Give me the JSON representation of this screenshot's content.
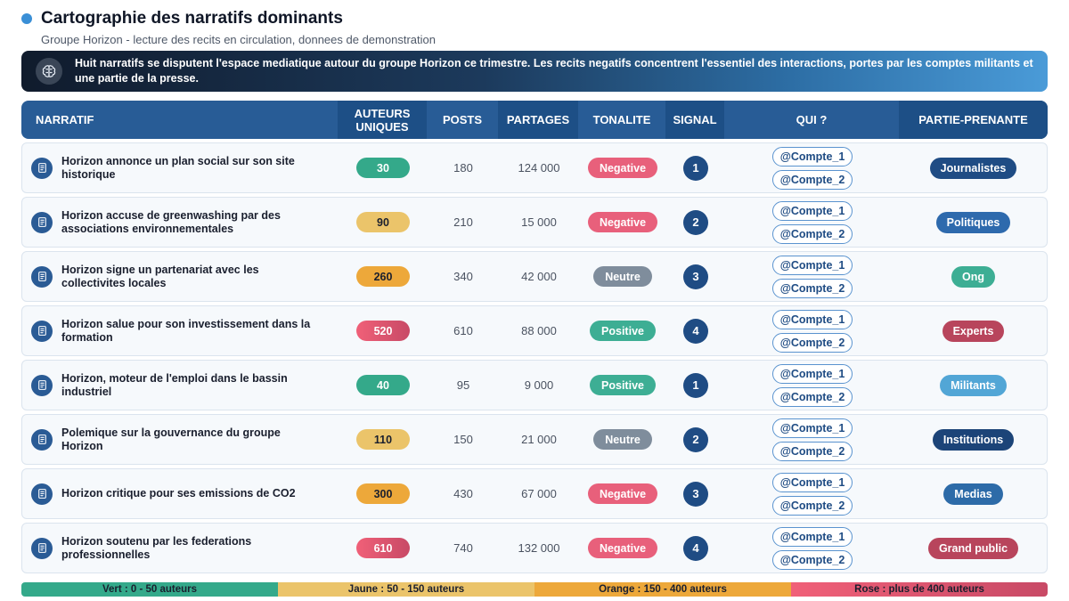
{
  "header": {
    "title": "Cartographie des narratifs dominants",
    "subtitle": "Groupe Horizon - lecture des recits en circulation, donnees de demonstration"
  },
  "banner": {
    "icon": "brain-icon",
    "text": "Huit narratifs se disputent l'espace mediatique autour du groupe Horizon ce trimestre. Les recits negatifs concentrent l'essentiel des interactions, portes par les comptes militants et une partie de la presse."
  },
  "columns": {
    "narratif": "NARRATIF",
    "auteurs": "AUTEURS UNIQUES",
    "posts": "POSTS",
    "partages": "PARTAGES",
    "tonalite": "TONALITE",
    "signal": "SIGNAL",
    "qui": "QUI ?",
    "partie": "PARTIE-PRENANTE"
  },
  "colors": {
    "vert": "#34a98a",
    "jaune": "#ebc46a",
    "orange": "#eda83a",
    "rose": "#e8556e",
    "negative": "#e8607b",
    "neutre": "#7f8d9c",
    "positive": "#3dae94"
  },
  "rows": [
    {
      "narratif": "Horizon annonce un plan social sur son site historique",
      "auteurs": "30",
      "auteurs_band": "vert",
      "posts": "180",
      "partages": "124 000",
      "tonalite": "Negative",
      "signal": "1",
      "qui": [
        "@Compte_1",
        "@Compte_2"
      ],
      "partie": "Journalistes",
      "partie_color": "#1f4c84"
    },
    {
      "narratif": "Horizon accuse de greenwashing par des associations environnementales",
      "auteurs": "90",
      "auteurs_band": "jaune",
      "posts": "210",
      "partages": "15 000",
      "tonalite": "Negative",
      "signal": "2",
      "qui": [
        "@Compte_1",
        "@Compte_2"
      ],
      "partie": "Politiques",
      "partie_color": "#2e6aad"
    },
    {
      "narratif": "Horizon signe un partenariat avec les collectivites locales",
      "auteurs": "260",
      "auteurs_band": "orange",
      "posts": "340",
      "partages": "42 000",
      "tonalite": "Neutre",
      "signal": "3",
      "qui": [
        "@Compte_1",
        "@Compte_2"
      ],
      "partie": "Ong",
      "partie_color": "#3dae94"
    },
    {
      "narratif": "Horizon salue pour son investissement dans la formation",
      "auteurs": "520",
      "auteurs_band": "rose",
      "posts": "610",
      "partages": "88 000",
      "tonalite": "Positive",
      "signal": "4",
      "qui": [
        "@Compte_1",
        "@Compte_2"
      ],
      "partie": "Experts",
      "partie_color": "#b8455c"
    },
    {
      "narratif": "Horizon, moteur de l'emploi dans le bassin industriel",
      "auteurs": "40",
      "auteurs_band": "vert",
      "posts": "95",
      "partages": "9 000",
      "tonalite": "Positive",
      "signal": "1",
      "qui": [
        "@Compte_1",
        "@Compte_2"
      ],
      "partie": "Militants",
      "partie_color": "#52a6d6"
    },
    {
      "narratif": "Polemique sur la gouvernance du groupe Horizon",
      "auteurs": "110",
      "auteurs_band": "jaune",
      "posts": "150",
      "partages": "21 000",
      "tonalite": "Neutre",
      "signal": "2",
      "qui": [
        "@Compte_1",
        "@Compte_2"
      ],
      "partie": "Institutions",
      "partie_color": "#1c4478"
    },
    {
      "narratif": "Horizon critique pour ses emissions de CO2",
      "auteurs": "300",
      "auteurs_band": "orange",
      "posts": "430",
      "partages": "67 000",
      "tonalite": "Negative",
      "signal": "3",
      "qui": [
        "@Compte_1",
        "@Compte_2"
      ],
      "partie": "Medias",
      "partie_color": "#2d6ba8"
    },
    {
      "narratif": "Horizon soutenu par les federations professionnelles",
      "auteurs": "610",
      "auteurs_band": "rose",
      "posts": "740",
      "partages": "132 000",
      "tonalite": "Negative",
      "signal": "4",
      "qui": [
        "@Compte_1",
        "@Compte_2"
      ],
      "partie": "Grand public",
      "partie_color": "#b8455c"
    }
  ],
  "legend": [
    {
      "label": "Vert : 0 - 50 auteurs",
      "band": "vert"
    },
    {
      "label": "Jaune : 50 - 150 auteurs",
      "band": "jaune"
    },
    {
      "label": "Orange : 150 - 400 auteurs",
      "band": "orange"
    },
    {
      "label": "Rose : plus de 400 auteurs",
      "band": "rose"
    }
  ]
}
